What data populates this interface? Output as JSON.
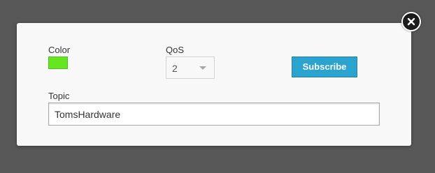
{
  "colors": {
    "backdrop": "#575757",
    "dialog_background": "#f8f8f8",
    "swatch": "#66e61f",
    "subscribe_button": "#2aa3cf"
  },
  "close_button": {
    "icon": "close-icon"
  },
  "form": {
    "color": {
      "label": "Color",
      "value": "#66e61f"
    },
    "qos": {
      "label": "QoS",
      "selected": "2",
      "icon": "chevron-down-icon"
    },
    "subscribe_label": "Subscribe",
    "topic": {
      "label": "Topic",
      "value": "TomsHardware"
    }
  }
}
